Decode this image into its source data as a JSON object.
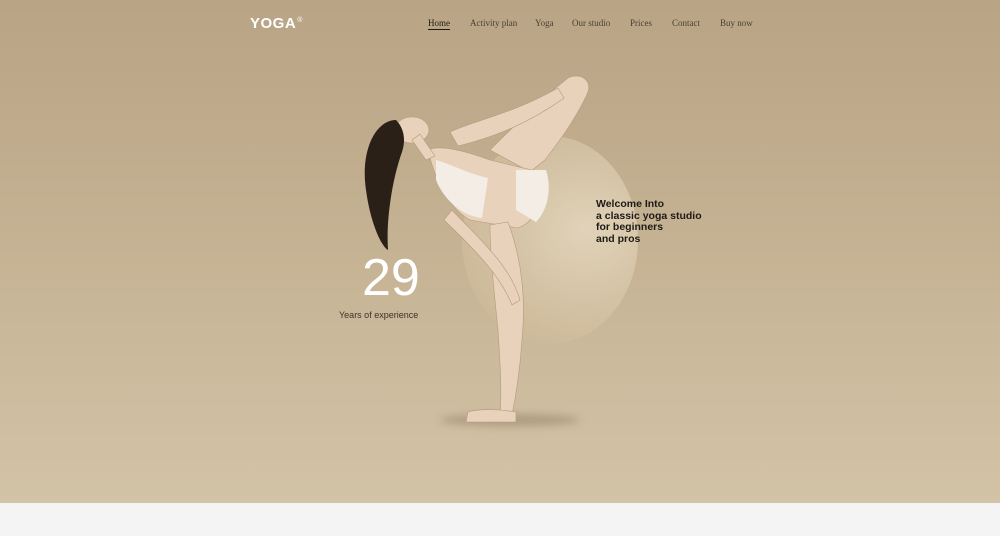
{
  "brand": {
    "logo": "YOGA",
    "logo_mark": "®"
  },
  "nav": {
    "items": [
      {
        "label": "Home",
        "active": true
      },
      {
        "label": "Activity plan",
        "active": false
      },
      {
        "label": "Yoga",
        "active": false
      },
      {
        "label": "Our studio",
        "active": false
      },
      {
        "label": "Prices",
        "active": false
      },
      {
        "label": "Contact",
        "active": false
      },
      {
        "label": "Buy now",
        "active": false
      }
    ]
  },
  "hero": {
    "stat_number": "29",
    "stat_label": "Years of experience",
    "welcome_lines": [
      "Welcome Into",
      "a classic yoga studio",
      "for beginners",
      "and pros"
    ]
  },
  "colors": {
    "hero_bg": "#c4b192",
    "text_dark": "#1e1a16",
    "text_light": "#ffffff",
    "page_bg": "#f5f4f5"
  },
  "icons": {
    "figure": "yoga-pose-photo"
  }
}
